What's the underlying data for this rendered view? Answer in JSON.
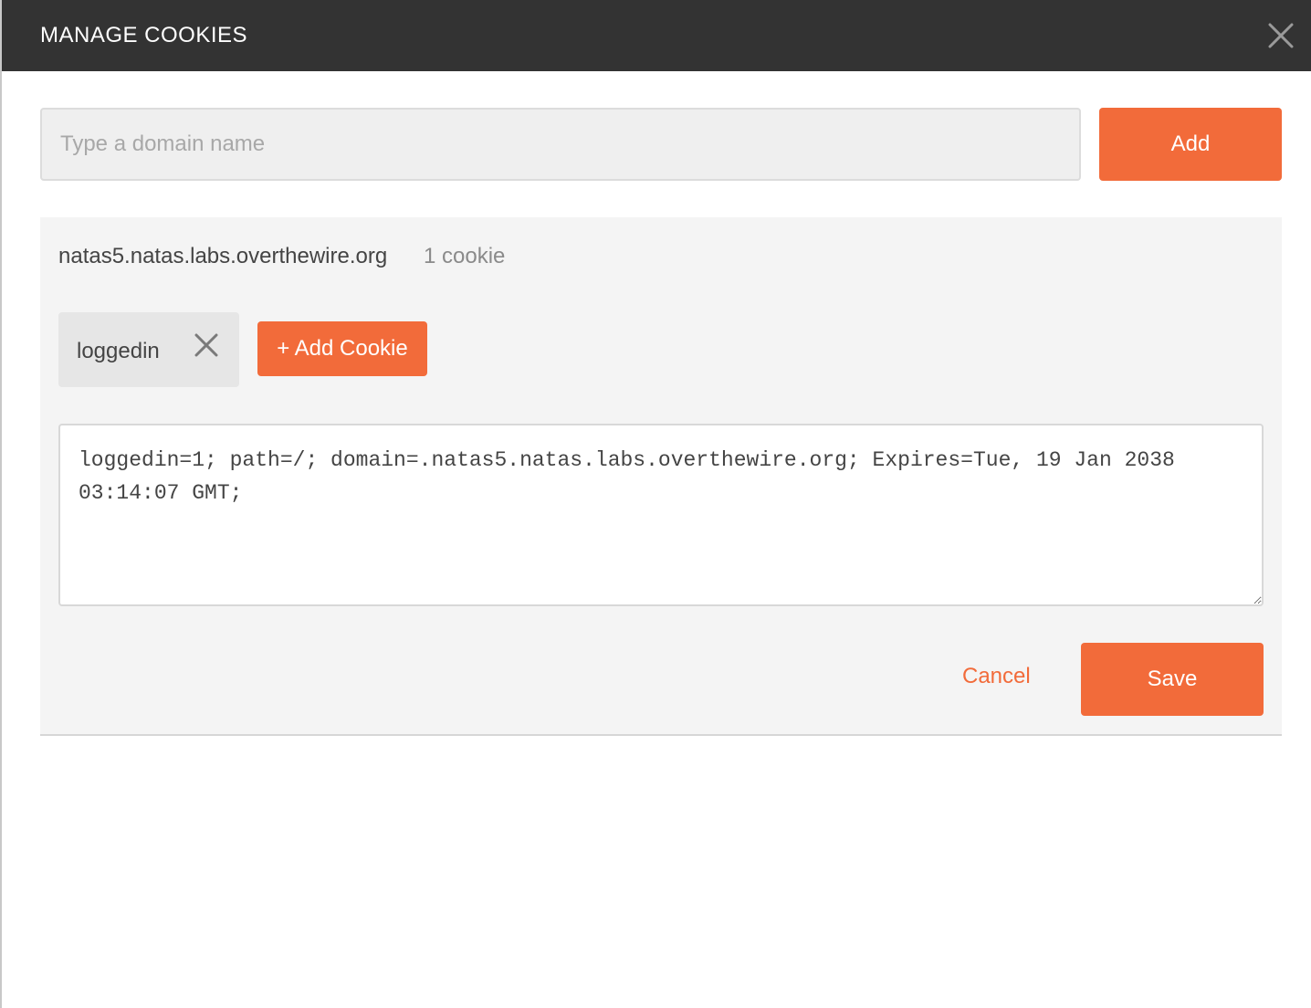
{
  "dialog": {
    "title": "MANAGE COOKIES"
  },
  "domain_form": {
    "placeholder": "Type a domain name",
    "value": "",
    "add_label": "Add"
  },
  "domain": {
    "name": "natas5.natas.labs.overthewire.org",
    "cookie_count": "1 cookie",
    "cookies": [
      {
        "name": "loggedin"
      }
    ],
    "add_cookie_label": "+ Add Cookie",
    "editor_value": "loggedin=1; path=/; domain=.natas5.natas.labs.overthewire.org; Expires=Tue, 19 Jan 2038 03:14:07 GMT;",
    "cancel_label": "Cancel",
    "save_label": "Save"
  },
  "colors": {
    "accent": "#f26b3a",
    "titlebar": "#333333",
    "panel": "#f4f4f4"
  }
}
